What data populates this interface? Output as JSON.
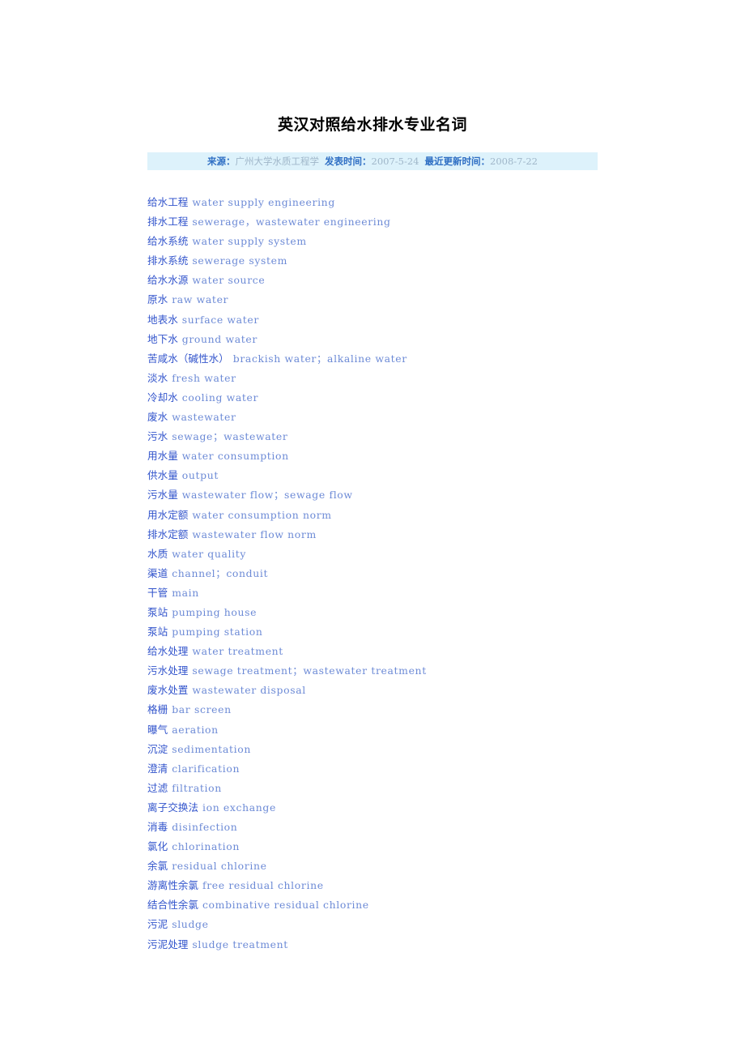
{
  "document": {
    "title": "英汉对照给水排水专业名词"
  },
  "meta": {
    "source_label": "来源：",
    "source_value": "广州大学水质工程学",
    "published_label": "发表时间：",
    "published_value": "2007-5-24",
    "updated_label": "最近更新时间：",
    "updated_value": "2008-7-22",
    "background_color": "#ddf2fb",
    "label_color": "#2f6fc4",
    "value_color": "#9fb6c9"
  },
  "colors": {
    "chinese_term": "#3355cc",
    "english_term": "#6c8ad6",
    "title": "#000000",
    "page_background": "#ffffff"
  },
  "terms": [
    {
      "cn": "给水工程",
      "en": "water supply engineering"
    },
    {
      "cn": "排水工程",
      "en": "sewerage，wastewater engineering"
    },
    {
      "cn": "给水系统",
      "en": "water supply system"
    },
    {
      "cn": "排水系统",
      "en": "sewerage system"
    },
    {
      "cn": "给水水源",
      "en": "water source"
    },
    {
      "cn": "原水",
      "en": "raw water"
    },
    {
      "cn": "地表水",
      "en": "surface water"
    },
    {
      "cn": "地下水",
      "en": "ground water"
    },
    {
      "cn": "苦咸水（碱性水）",
      "en": "brackish water；alkaline water"
    },
    {
      "cn": "淡水",
      "en": "fresh water"
    },
    {
      "cn": "冷却水",
      "en": "cooling water"
    },
    {
      "cn": "废水",
      "en": "wastewater"
    },
    {
      "cn": "污水",
      "en": "sewage；wastewater"
    },
    {
      "cn": "用水量",
      "en": "water consumption"
    },
    {
      "cn": "供水量",
      "en": "output"
    },
    {
      "cn": "污水量",
      "en": "wastewater flow；sewage flow"
    },
    {
      "cn": "用水定额",
      "en": "water consumption norm"
    },
    {
      "cn": "排水定额",
      "en": "wastewater flow norm"
    },
    {
      "cn": "水质",
      "en": "water quality"
    },
    {
      "cn": "渠道",
      "en": "channel；conduit"
    },
    {
      "cn": "干管",
      "en": "main"
    },
    {
      "cn": "泵站",
      "en": "pumping house"
    },
    {
      "cn": "泵站",
      "en": "pumping station"
    },
    {
      "cn": "给水处理",
      "en": "water treatment"
    },
    {
      "cn": "污水处理",
      "en": "sewage treatment；wastewater treatment"
    },
    {
      "cn": "废水处置",
      "en": "wastewater disposal"
    },
    {
      "cn": "格栅",
      "en": "bar screen"
    },
    {
      "cn": "曝气",
      "en": "aeration"
    },
    {
      "cn": "沉淀",
      "en": "sedimentation"
    },
    {
      "cn": "澄清",
      "en": "clarification"
    },
    {
      "cn": "过滤",
      "en": "filtration"
    },
    {
      "cn": "离子交换法",
      "en": "ion exchange"
    },
    {
      "cn": "消毒",
      "en": "disinfection"
    },
    {
      "cn": "氯化",
      "en": "chlorination"
    },
    {
      "cn": "余氯",
      "en": "residual chlorine"
    },
    {
      "cn": "游离性余氯",
      "en": "free residual chlorine"
    },
    {
      "cn": "结合性余氯",
      "en": "combinative residual chlorine"
    },
    {
      "cn": "污泥",
      "en": "sludge"
    },
    {
      "cn": "污泥处理",
      "en": "sludge treatment"
    }
  ]
}
